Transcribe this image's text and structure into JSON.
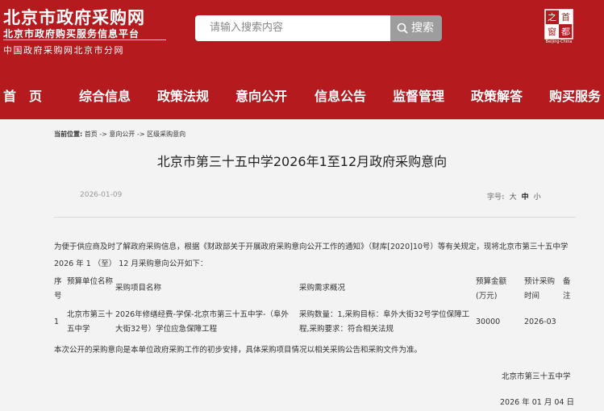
{
  "site": {
    "title": "北京市政府采购网",
    "subtitle": "北京市政府购买服务信息平台",
    "subtitle2": "中国政府采购网北京市分网",
    "emblem_text": "首都之窗",
    "emblem_caption": "Beijing·China"
  },
  "search": {
    "placeholder": "请输入搜索内容",
    "button": "搜索"
  },
  "nav": [
    "首　页",
    "综合信息",
    "政策法规",
    "意向公开",
    "信息公告",
    "监督管理",
    "政策解答",
    "购买服务"
  ],
  "breadcrumb": {
    "label": "当前位置:",
    "path": "首页 -> 意向公开 -> 区级采购意向"
  },
  "article": {
    "title": "北京市第三十五中学2026年1至12月政府采购意向",
    "date": "2026-01-09",
    "font_label": "字号:",
    "font_sizes": [
      "大",
      "中",
      "小"
    ],
    "intro": "为便于供应商及时了解政府采购信息，根据《财政部关于开展政府采购意向公开工作的通知》（财库[2020]10号）等有关规定，现将北京市第三十五中学2026 年 1 （至） 12 月采购意向公开如下：",
    "table": {
      "headers": {
        "seq": "序号",
        "unit": "预算单位名称",
        "project": "采购项目名称",
        "summary": "采购需求概况",
        "budget": "预算金额(万元)",
        "time": "预计采购时间",
        "note": "备注"
      },
      "rows": [
        {
          "seq": "1",
          "unit": "北京市第三十五中学",
          "project": "2026年修缮经费-学保-北京市第三十五中学-（阜外大街32号）学位应急保障工程",
          "summary": "采购数量：1,采购目标：阜外大街32号学位保障工程,采购要求：符合相关法规",
          "budget": "30000",
          "time": "2026-03",
          "note": ""
        }
      ]
    },
    "closing": "本次公开的采购意向是本单位政府采购工作的初步安排，具体采购项目情况以相关采购公告和采购文件为准。",
    "signature": "北京市第三十五中学",
    "sign_date": "2026 年 01 月 04 日"
  },
  "colors": {
    "brand_red": "#b41a1e",
    "search_button": "#9d9d9d"
  }
}
